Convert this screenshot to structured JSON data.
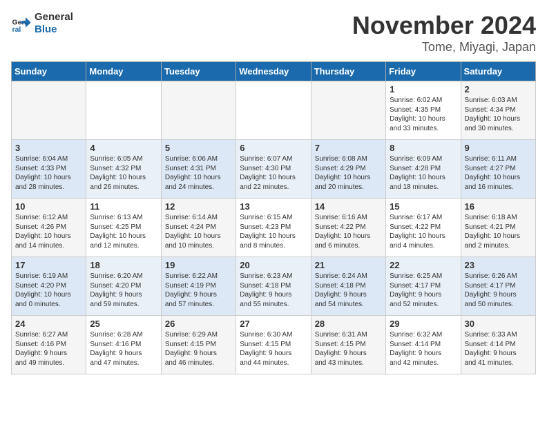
{
  "logo": {
    "text_general": "General",
    "text_blue": "Blue"
  },
  "title": {
    "month": "November 2024",
    "location": "Tome, Miyagi, Japan"
  },
  "weekdays": [
    "Sunday",
    "Monday",
    "Tuesday",
    "Wednesday",
    "Thursday",
    "Friday",
    "Saturday"
  ],
  "weeks": [
    [
      {
        "day": "",
        "info": ""
      },
      {
        "day": "",
        "info": ""
      },
      {
        "day": "",
        "info": ""
      },
      {
        "day": "",
        "info": ""
      },
      {
        "day": "",
        "info": ""
      },
      {
        "day": "1",
        "info": "Sunrise: 6:02 AM\nSunset: 4:35 PM\nDaylight: 10 hours\nand 33 minutes."
      },
      {
        "day": "2",
        "info": "Sunrise: 6:03 AM\nSunset: 4:34 PM\nDaylight: 10 hours\nand 30 minutes."
      }
    ],
    [
      {
        "day": "3",
        "info": "Sunrise: 6:04 AM\nSunset: 4:33 PM\nDaylight: 10 hours\nand 28 minutes."
      },
      {
        "day": "4",
        "info": "Sunrise: 6:05 AM\nSunset: 4:32 PM\nDaylight: 10 hours\nand 26 minutes."
      },
      {
        "day": "5",
        "info": "Sunrise: 6:06 AM\nSunset: 4:31 PM\nDaylight: 10 hours\nand 24 minutes."
      },
      {
        "day": "6",
        "info": "Sunrise: 6:07 AM\nSunset: 4:30 PM\nDaylight: 10 hours\nand 22 minutes."
      },
      {
        "day": "7",
        "info": "Sunrise: 6:08 AM\nSunset: 4:29 PM\nDaylight: 10 hours\nand 20 minutes."
      },
      {
        "day": "8",
        "info": "Sunrise: 6:09 AM\nSunset: 4:28 PM\nDaylight: 10 hours\nand 18 minutes."
      },
      {
        "day": "9",
        "info": "Sunrise: 6:11 AM\nSunset: 4:27 PM\nDaylight: 10 hours\nand 16 minutes."
      }
    ],
    [
      {
        "day": "10",
        "info": "Sunrise: 6:12 AM\nSunset: 4:26 PM\nDaylight: 10 hours\nand 14 minutes."
      },
      {
        "day": "11",
        "info": "Sunrise: 6:13 AM\nSunset: 4:25 PM\nDaylight: 10 hours\nand 12 minutes."
      },
      {
        "day": "12",
        "info": "Sunrise: 6:14 AM\nSunset: 4:24 PM\nDaylight: 10 hours\nand 10 minutes."
      },
      {
        "day": "13",
        "info": "Sunrise: 6:15 AM\nSunset: 4:23 PM\nDaylight: 10 hours\nand 8 minutes."
      },
      {
        "day": "14",
        "info": "Sunrise: 6:16 AM\nSunset: 4:22 PM\nDaylight: 10 hours\nand 6 minutes."
      },
      {
        "day": "15",
        "info": "Sunrise: 6:17 AM\nSunset: 4:22 PM\nDaylight: 10 hours\nand 4 minutes."
      },
      {
        "day": "16",
        "info": "Sunrise: 6:18 AM\nSunset: 4:21 PM\nDaylight: 10 hours\nand 2 minutes."
      }
    ],
    [
      {
        "day": "17",
        "info": "Sunrise: 6:19 AM\nSunset: 4:20 PM\nDaylight: 10 hours\nand 0 minutes."
      },
      {
        "day": "18",
        "info": "Sunrise: 6:20 AM\nSunset: 4:20 PM\nDaylight: 9 hours\nand 59 minutes."
      },
      {
        "day": "19",
        "info": "Sunrise: 6:22 AM\nSunset: 4:19 PM\nDaylight: 9 hours\nand 57 minutes."
      },
      {
        "day": "20",
        "info": "Sunrise: 6:23 AM\nSunset: 4:18 PM\nDaylight: 9 hours\nand 55 minutes."
      },
      {
        "day": "21",
        "info": "Sunrise: 6:24 AM\nSunset: 4:18 PM\nDaylight: 9 hours\nand 54 minutes."
      },
      {
        "day": "22",
        "info": "Sunrise: 6:25 AM\nSunset: 4:17 PM\nDaylight: 9 hours\nand 52 minutes."
      },
      {
        "day": "23",
        "info": "Sunrise: 6:26 AM\nSunset: 4:17 PM\nDaylight: 9 hours\nand 50 minutes."
      }
    ],
    [
      {
        "day": "24",
        "info": "Sunrise: 6:27 AM\nSunset: 4:16 PM\nDaylight: 9 hours\nand 49 minutes."
      },
      {
        "day": "25",
        "info": "Sunrise: 6:28 AM\nSunset: 4:16 PM\nDaylight: 9 hours\nand 47 minutes."
      },
      {
        "day": "26",
        "info": "Sunrise: 6:29 AM\nSunset: 4:15 PM\nDaylight: 9 hours\nand 46 minutes."
      },
      {
        "day": "27",
        "info": "Sunrise: 6:30 AM\nSunset: 4:15 PM\nDaylight: 9 hours\nand 44 minutes."
      },
      {
        "day": "28",
        "info": "Sunrise: 6:31 AM\nSunset: 4:15 PM\nDaylight: 9 hours\nand 43 minutes."
      },
      {
        "day": "29",
        "info": "Sunrise: 6:32 AM\nSunset: 4:14 PM\nDaylight: 9 hours\nand 42 minutes."
      },
      {
        "day": "30",
        "info": "Sunrise: 6:33 AM\nSunset: 4:14 PM\nDaylight: 9 hours\nand 41 minutes."
      }
    ]
  ]
}
